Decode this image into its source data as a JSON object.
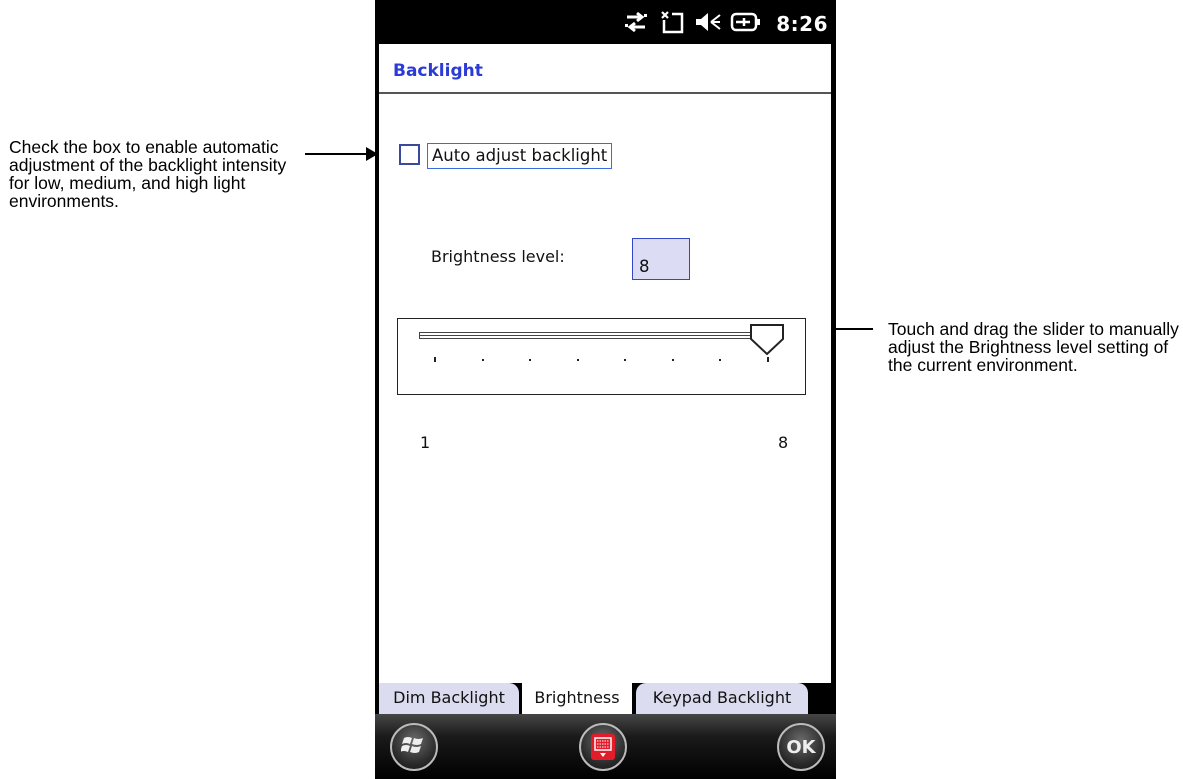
{
  "annotations": {
    "left_note": "Check the box to enable automatic adjustment of the backlight intensity for low, medium, and high light environments.",
    "right_note": "Touch and drag the slider to manually adjust the Brightness level setting of the current environment."
  },
  "status_bar": {
    "time": "8:26",
    "icons": [
      "data-sync-icon",
      "no-sim-icon",
      "speaker-muted-icon",
      "battery-charging-icon"
    ]
  },
  "screen": {
    "title": "Backlight",
    "auto_adjust": {
      "label": "Auto adjust backlight",
      "checked": false
    },
    "brightness": {
      "label": "Brightness level:",
      "value": "8"
    },
    "slider": {
      "min": 1,
      "max": 8,
      "value": 8,
      "min_label": "1",
      "max_label": "8"
    }
  },
  "tabs": [
    {
      "label": "Dim Backlight",
      "active": false
    },
    {
      "label": "Brightness",
      "active": true
    },
    {
      "label": "Keypad Backlight",
      "active": false
    }
  ],
  "bottom_bar": {
    "start_icon": "windows-logo-icon",
    "keyboard_icon": "keyboard-icon",
    "ok_label": "OK"
  },
  "colors": {
    "title": "#2a3bd6",
    "input_bg": "#dcdcf5",
    "tab_bg": "#dcdcf0"
  }
}
